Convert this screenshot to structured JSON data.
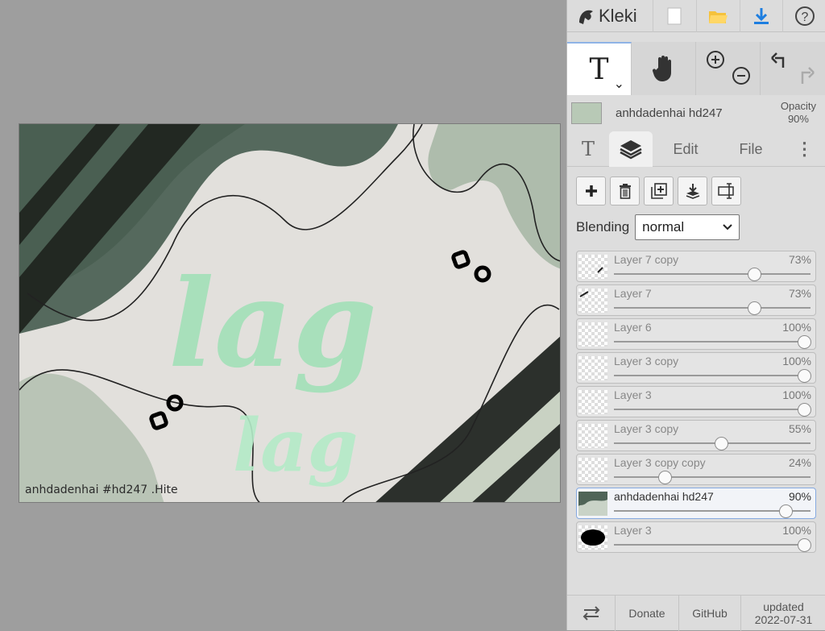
{
  "app": {
    "name": "Kleki"
  },
  "canvas": {
    "big_text": "lag",
    "small_text": "lag",
    "watermark": "anhdadenhai #hd247 .Hite"
  },
  "topbar": {
    "icons": [
      "new-file-icon",
      "open-folder-icon",
      "download-icon",
      "help-icon"
    ],
    "help_glyph": "?"
  },
  "tools": {
    "text_tool_glyph": "T",
    "dropdown_glyph": "⌄"
  },
  "active_layer": {
    "name": "anhdadenhai hd247",
    "opacity_label": "Opacity",
    "opacity_value": "90%"
  },
  "tabs": {
    "text_tab": "T",
    "edit": "Edit",
    "file": "File",
    "more": "⋮"
  },
  "blending": {
    "label": "Blending",
    "value": "normal"
  },
  "layers": [
    {
      "name": "Layer 7 copy",
      "opacity": 73
    },
    {
      "name": "Layer 7",
      "opacity": 73
    },
    {
      "name": "Layer 6",
      "opacity": 100
    },
    {
      "name": "Layer 3 copy",
      "opacity": 100
    },
    {
      "name": "Layer 3",
      "opacity": 100
    },
    {
      "name": "Layer 3 copy",
      "opacity": 55
    },
    {
      "name": "Layer 3 copy copy",
      "opacity": 24
    },
    {
      "name": "anhdadenhai hd247",
      "opacity": 90,
      "active": true
    },
    {
      "name": "Layer 3",
      "opacity": 100
    }
  ],
  "bottombar": {
    "donate": "Donate",
    "github": "GitHub",
    "updated_label": "updated",
    "updated_date": "2022-07-31"
  },
  "colors": {
    "accent": "#8fb3e6",
    "panel_bg": "#dddddd",
    "canvas_green": "#9fe0b6"
  }
}
